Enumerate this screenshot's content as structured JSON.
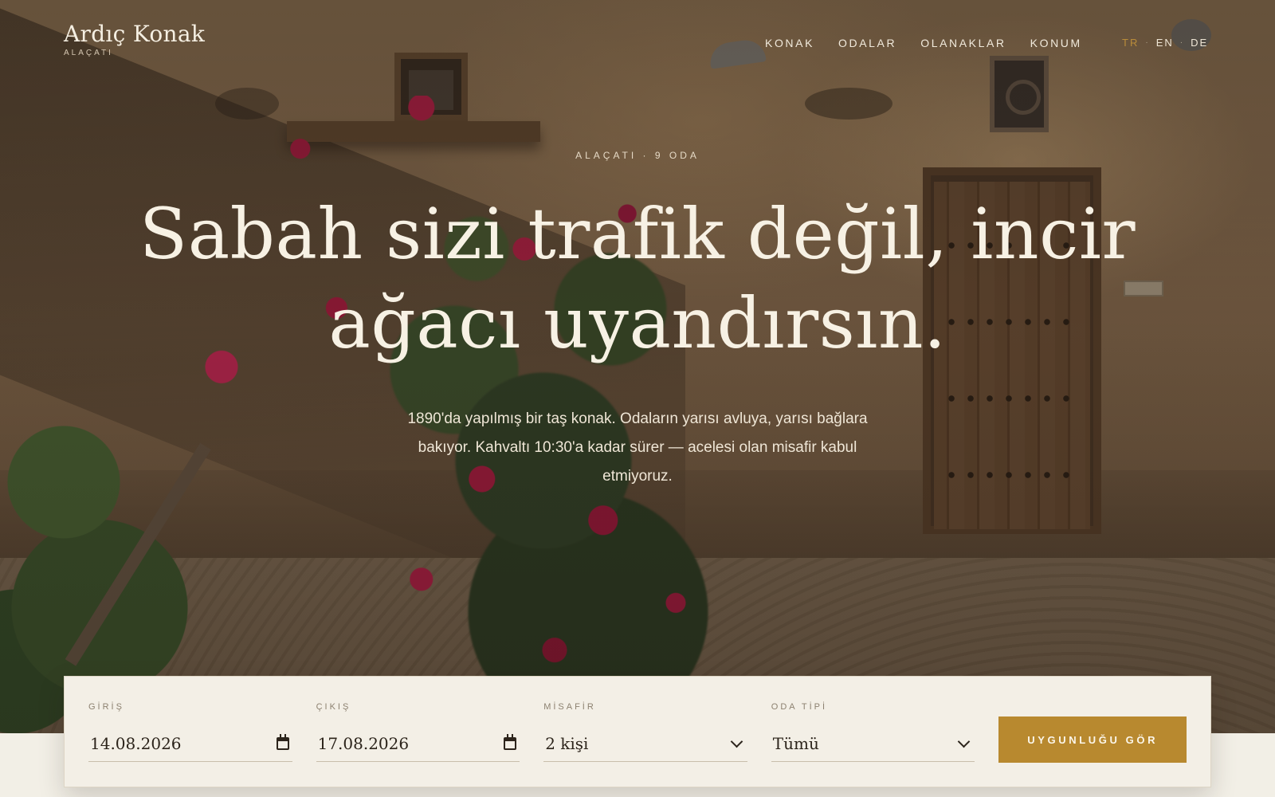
{
  "brand": {
    "name": "Ardıç Konak",
    "location": "ALAÇATI"
  },
  "nav": {
    "items": [
      {
        "label": "KONAK"
      },
      {
        "label": "ODALAR"
      },
      {
        "label": "OLANAKLAR"
      },
      {
        "label": "KONUM"
      }
    ]
  },
  "languages": {
    "items": [
      "TR",
      "EN",
      "DE"
    ],
    "active": "TR",
    "separator": "·"
  },
  "hero": {
    "eyebrow": "ALAÇATI · 9 ODA",
    "headline_line1": "Sabah sizi trafik değil, incir",
    "headline_line2": "ağacı uyandırsın.",
    "lede": "1890'da yapılmış bir taş konak. Odaların yarısı avluya, yarısı bağlara bakıyor. Kahvaltı 10:30'a kadar sürer — acelesi olan misafir kabul etmiyoruz."
  },
  "booking": {
    "checkin": {
      "label": "GİRİŞ",
      "value": "14.08.2026",
      "icon": "calendar-icon"
    },
    "checkout": {
      "label": "ÇIKIŞ",
      "value": "17.08.2026",
      "icon": "calendar-icon"
    },
    "guests": {
      "label": "MİSAFİR",
      "value": "2 kişi",
      "icon": "chevron-down-icon"
    },
    "room_type": {
      "label": "ODA TİPİ",
      "value": "Tümü",
      "icon": "chevron-down-icon"
    },
    "cta_label": "UYGUNLUĞU GÖR"
  },
  "colors": {
    "accent": "#b8892f",
    "active_language": "#b98c3a",
    "booking_background": "#f3efe6",
    "headline": "#f7f1e4"
  }
}
